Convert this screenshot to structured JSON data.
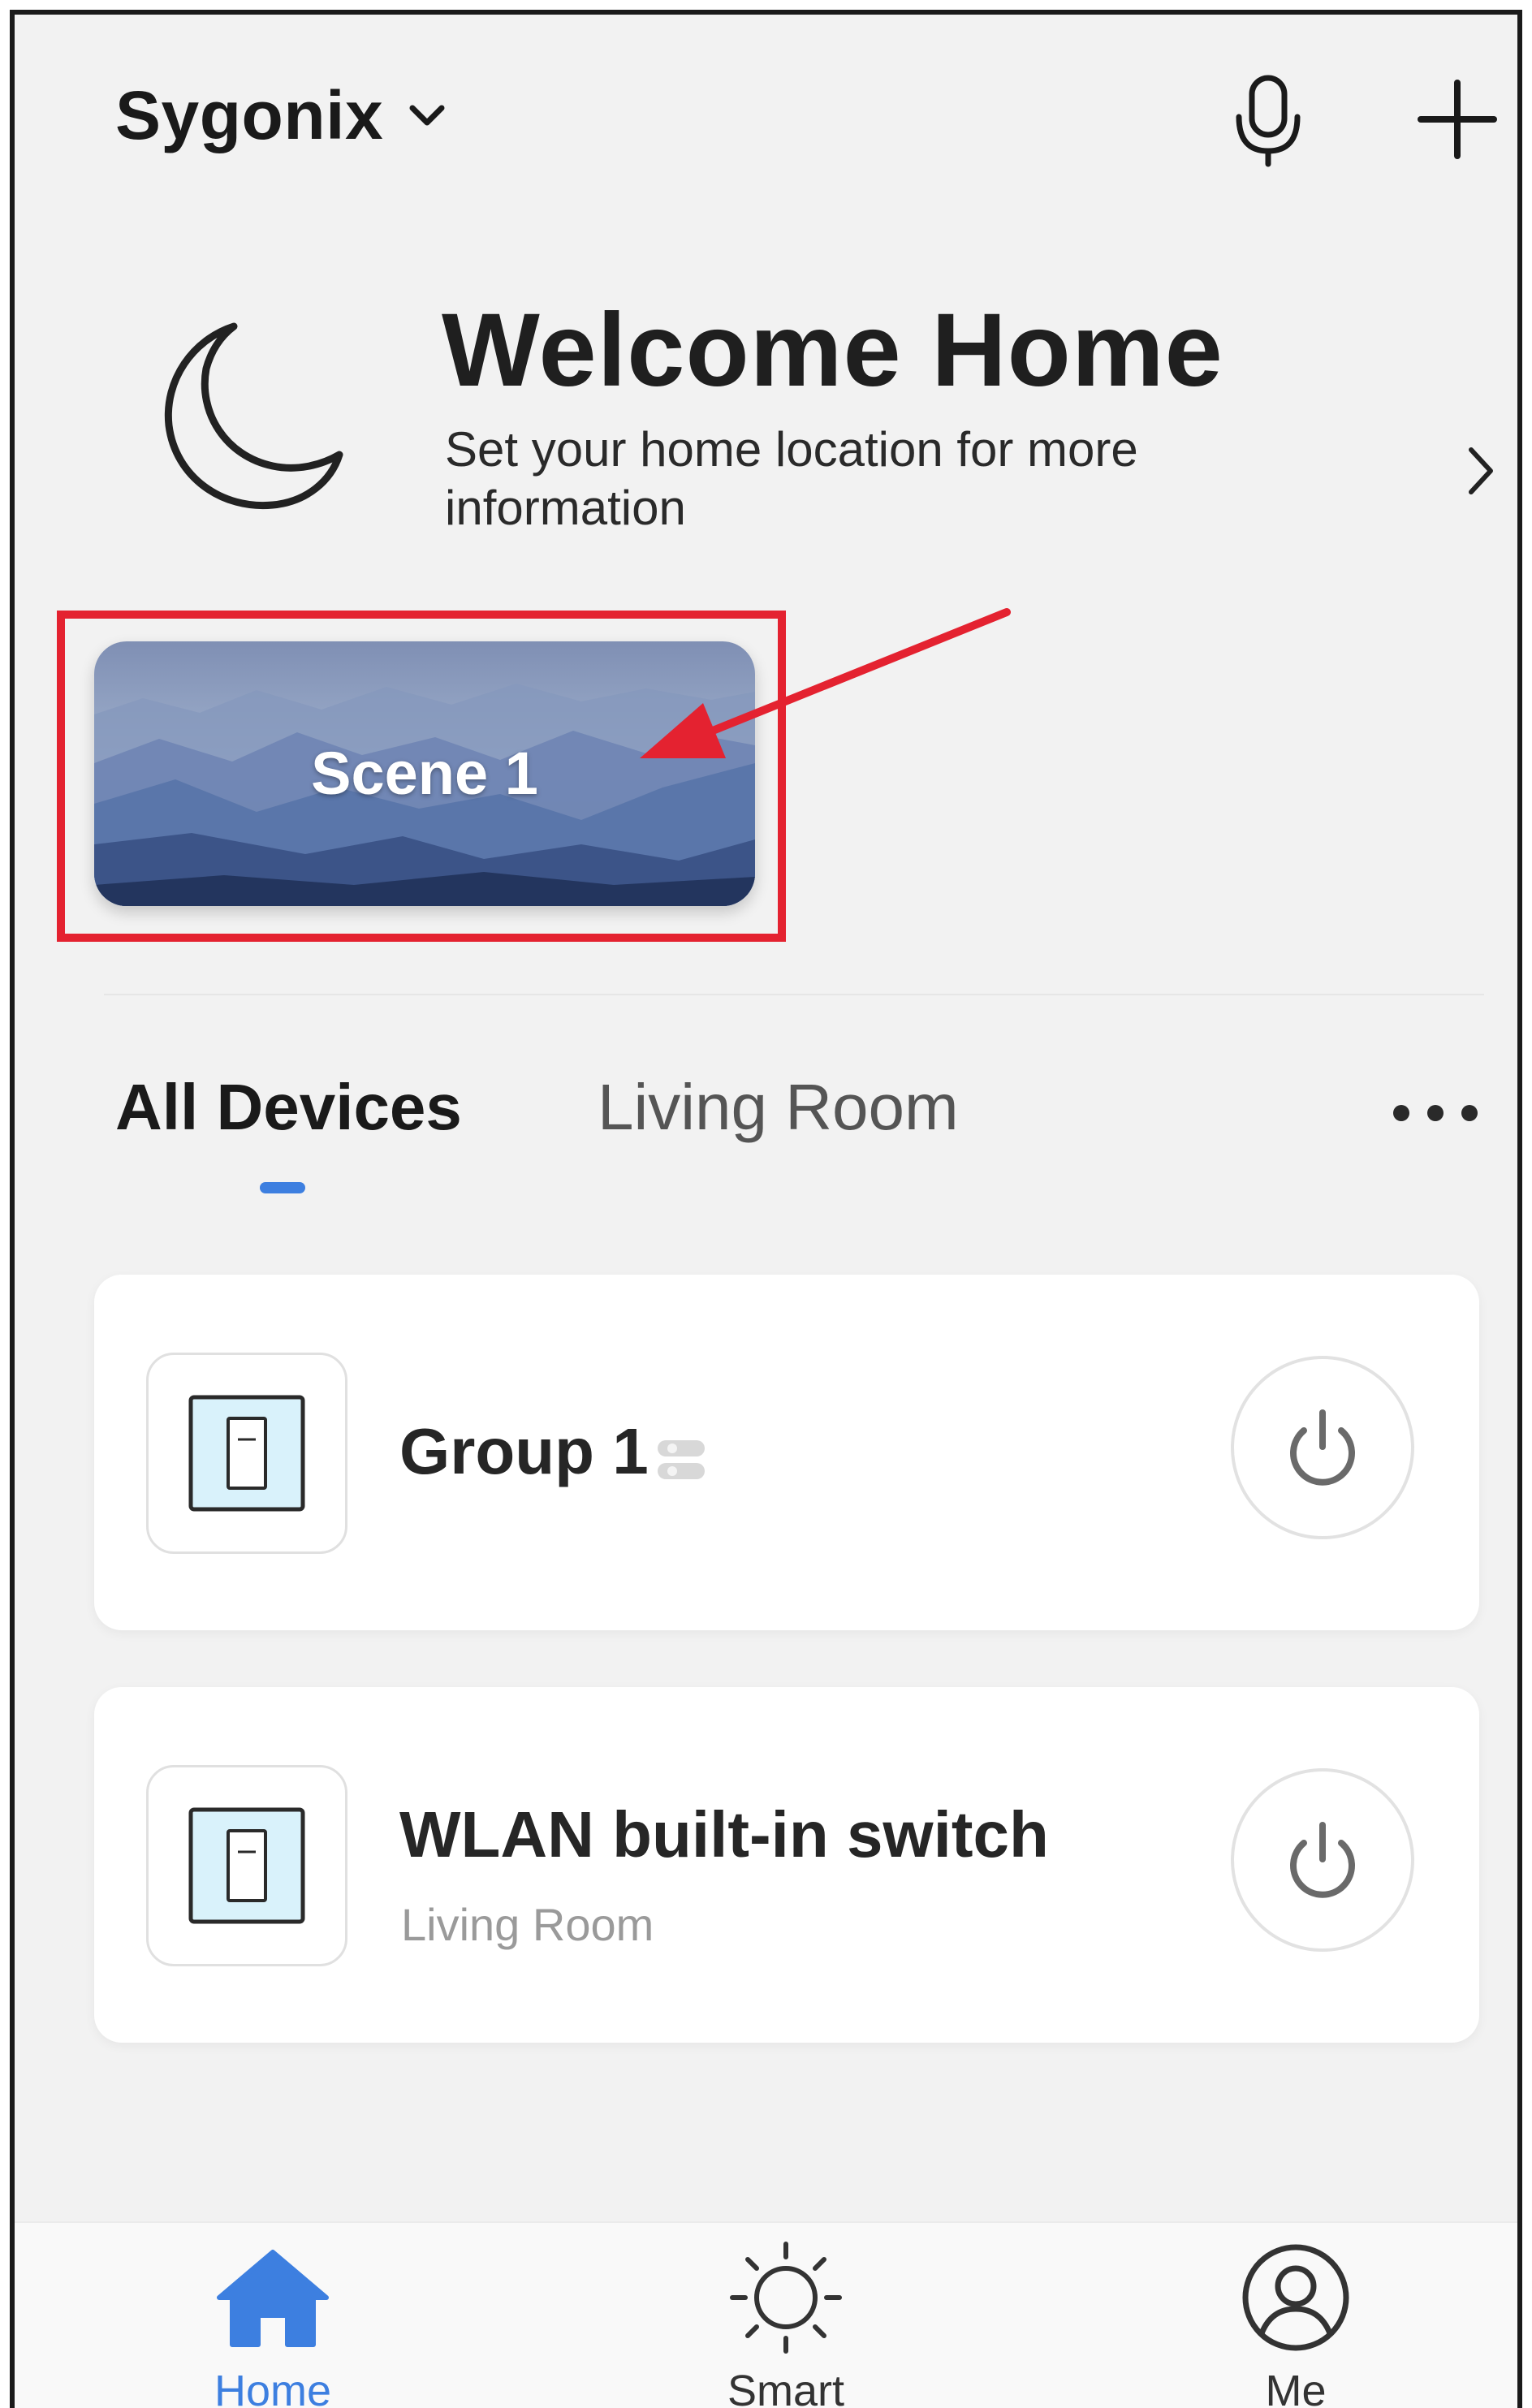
{
  "header": {
    "home_name": "Sygonix",
    "icons": {
      "dropdown": "chevron-down-icon",
      "voice": "microphone-icon",
      "add": "plus-icon"
    }
  },
  "welcome": {
    "title": "Welcome Home",
    "subtitle": "Set your home location for more information",
    "icon": "moon-icon",
    "action_icon": "chevron-right-icon"
  },
  "scenes": [
    {
      "label": "Scene 1"
    }
  ],
  "annotation": {
    "color": "#e42230",
    "type": "highlight-box-with-arrow"
  },
  "tabs": {
    "items": [
      {
        "label": "All Devices",
        "active": true
      },
      {
        "label": "Living Room",
        "active": false
      }
    ],
    "more_icon": "more-horizontal-icon",
    "indicator_color": "#3d7fe0"
  },
  "devices": [
    {
      "name": "Group 1",
      "room": "",
      "is_group": true,
      "icon": "switch-icon",
      "power_icon": "power-icon"
    },
    {
      "name": "WLAN built-in switch",
      "room": "Living Room",
      "is_group": false,
      "icon": "switch-icon",
      "power_icon": "power-icon"
    }
  ],
  "bottom_nav": {
    "items": [
      {
        "label": "Home",
        "icon": "home-icon",
        "active": true
      },
      {
        "label": "Smart",
        "icon": "sun-icon",
        "active": false
      },
      {
        "label": "Me",
        "icon": "profile-icon",
        "active": false
      }
    ],
    "active_color": "#3d7fe0"
  },
  "colors": {
    "background": "#f2f2f2",
    "card": "#ffffff",
    "accent": "#3d7fe0",
    "highlight": "#e42230"
  }
}
